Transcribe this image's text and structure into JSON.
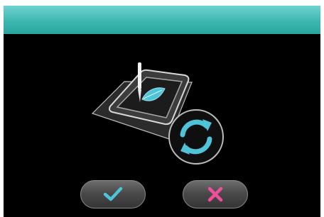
{
  "screen": {
    "title": "",
    "accent_color": "#3fb7b1"
  },
  "illustration": {
    "subject": "embroidery-hoop-with-needle",
    "action_icon": "rotate-refresh-icon"
  },
  "footer": {
    "ok_icon": "checkmark-icon",
    "ok_color": "#4fc3d8",
    "cancel_icon": "x-icon",
    "cancel_color": "#f0509a"
  }
}
